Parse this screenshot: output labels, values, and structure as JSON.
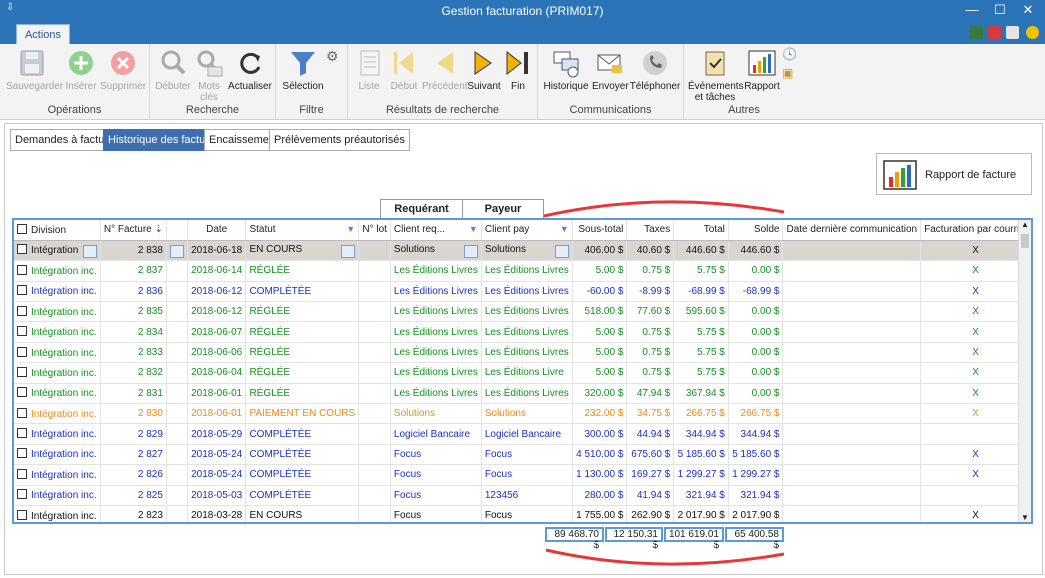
{
  "window": {
    "title": "Gestion facturation (PRIM017)",
    "icon": "menu-pin-icon"
  },
  "ribbon_tab": "Actions",
  "groups": [
    {
      "name": "Opérations",
      "buttons": [
        "Sauvegarder",
        "Insérer",
        "Supprimer"
      ]
    },
    {
      "name": "Recherche",
      "buttons": [
        "Débuter",
        "Mots clés",
        "Actualiser"
      ]
    },
    {
      "name": "Filtre",
      "buttons": [
        "Sélection"
      ]
    },
    {
      "name": "Résultats de recherche",
      "buttons": [
        "Liste",
        "Début",
        "Précédent",
        "Suivant",
        "Fin"
      ]
    },
    {
      "name": "Communications",
      "buttons": [
        "Historique",
        "Envoyer",
        "Téléphoner"
      ]
    },
    {
      "name": "Autres",
      "buttons": [
        "Événements et tâches",
        "Rapport"
      ]
    }
  ],
  "view_tabs": [
    "Demandes à facturer",
    "Historique des factures",
    "Encaissements",
    "Prélèvements préautorisés"
  ],
  "report_button": "Rapport de facture",
  "group_headers": {
    "requerant": "Requérant",
    "payeur": "Payeur"
  },
  "columns": [
    "Division",
    "N° Facture",
    "Date",
    "Statut",
    "N° lot",
    "Client req...",
    "Client pay",
    "Sous-total",
    "Taxes",
    "Total",
    "Solde",
    "Date dernière communication",
    "Facturation par courriel"
  ],
  "rows": [
    {
      "division": "Intégration",
      "no": "2 838",
      "date": "2018-06-18",
      "statut": "EN COURS",
      "lot": "",
      "req": "Solutions",
      "pay": "Solutions",
      "sous": "406.00 $",
      "taxes": "40.60 $",
      "total": "446.60 $",
      "solde": "446.60 $",
      "courriel": "X",
      "color": "bk",
      "selected": true
    },
    {
      "division": "Intégration inc.",
      "no": "2 837",
      "date": "2018-06-14",
      "statut": "RÉGLÉE",
      "lot": "",
      "req": "Les Éditions Livres",
      "pay": "Les Éditions Livres",
      "sous": "5.00 $",
      "taxes": "0.75 $",
      "total": "5.75 $",
      "solde": "0.00 $",
      "courriel": "X",
      "color": "gr"
    },
    {
      "division": "Intégration inc.",
      "no": "2 836",
      "date": "2018-06-12",
      "statut": "COMPLÉTÉE",
      "lot": "",
      "req": "Les Éditions Livres",
      "pay": "Les Éditions Livres",
      "sous": "-60.00 $",
      "taxes": "-8.99 $",
      "total": "-68.99 $",
      "solde": "-68.99 $",
      "courriel": "X",
      "color": "bl"
    },
    {
      "division": "Intégration inc.",
      "no": "2 835",
      "date": "2018-06-12",
      "statut": "RÉGLÉE",
      "lot": "",
      "req": "Les Éditions Livres",
      "pay": "Les Éditions Livres",
      "sous": "518.00 $",
      "taxes": "77.60 $",
      "total": "595.60 $",
      "solde": "0.00 $",
      "courriel": "X",
      "color": "gr"
    },
    {
      "division": "Intégration inc.",
      "no": "2 834",
      "date": "2018-06-07",
      "statut": "RÉGLÉE",
      "lot": "",
      "req": "Les Éditions Livres",
      "pay": "Les Éditions Livres",
      "sous": "5.00 $",
      "taxes": "0.75 $",
      "total": "5.75 $",
      "solde": "0.00 $",
      "courriel": "X",
      "color": "gr"
    },
    {
      "division": "Intégration inc.",
      "no": "2 833",
      "date": "2018-06-06",
      "statut": "RÉGLÉE",
      "lot": "",
      "req": "Les Éditions Livres",
      "pay": "Les Éditions Livres",
      "sous": "5.00 $",
      "taxes": "0.75 $",
      "total": "5.75 $",
      "solde": "0.00 $",
      "courriel": "X",
      "color": "gr"
    },
    {
      "division": "Intégration inc.",
      "no": "2 832",
      "date": "2018-06-04",
      "statut": "RÉGLÉE",
      "lot": "",
      "req": "Les Éditions Livres",
      "pay": "Les Éditions Livre",
      "sous": "5.00 $",
      "taxes": "0.75 $",
      "total": "5.75 $",
      "solde": "0.00 $",
      "courriel": "X",
      "color": "gr"
    },
    {
      "division": "Intégration inc.",
      "no": "2 831",
      "date": "2018-06-01",
      "statut": "RÉGLÉE",
      "lot": "",
      "req": "Les Éditions Livres",
      "pay": "Les Éditions Livres",
      "sous": "320.00 $",
      "taxes": "47.94 $",
      "total": "367.94 $",
      "solde": "0.00 $",
      "courriel": "X",
      "color": "gr"
    },
    {
      "division": "Intégration inc.",
      "no": "2 830",
      "date": "2018-06-01",
      "statut": "PAIEMENT EN COURS",
      "lot": "",
      "req": "Solutions",
      "pay": "Solutions",
      "sous": "232.00 $",
      "taxes": "34.75 $",
      "total": "266.75 $",
      "solde": "266.75 $",
      "courriel": "X",
      "color": "or"
    },
    {
      "division": "Intégration inc.",
      "no": "2 829",
      "date": "2018-05-29",
      "statut": "COMPLÉTÉE",
      "lot": "",
      "req": "Logiciel Bancaire",
      "pay": "Logiciel Bancaire",
      "sous": "300.00 $",
      "taxes": "44.94 $",
      "total": "344.94 $",
      "solde": "344.94 $",
      "courriel": "",
      "color": "bl"
    },
    {
      "division": "Intégration inc.",
      "no": "2 827",
      "date": "2018-05-24",
      "statut": "COMPLÉTÉE",
      "lot": "",
      "req": "Focus",
      "pay": "Focus",
      "sous": "4 510.00 $",
      "taxes": "675.60 $",
      "total": "5 185.60 $",
      "solde": "5 185.60 $",
      "courriel": "X",
      "color": "bl"
    },
    {
      "division": "Intégration inc.",
      "no": "2 826",
      "date": "2018-05-24",
      "statut": "COMPLÉTÉE",
      "lot": "",
      "req": "Focus",
      "pay": "Focus",
      "sous": "1 130.00 $",
      "taxes": "169.27 $",
      "total": "1 299.27 $",
      "solde": "1 299.27 $",
      "courriel": "X",
      "color": "bl"
    },
    {
      "division": "Intégration inc.",
      "no": "2 825",
      "date": "2018-05-03",
      "statut": "COMPLÉTÉE",
      "lot": "",
      "req": "Focus",
      "pay": "123456",
      "sous": "280.00 $",
      "taxes": "41.94 $",
      "total": "321.94 $",
      "solde": "321.94 $",
      "courriel": "",
      "color": "bl"
    },
    {
      "division": "Intégration inc.",
      "no": "2 823",
      "date": "2018-03-28",
      "statut": "EN COURS",
      "lot": "",
      "req": "Focus",
      "pay": "Focus",
      "sous": "1 755.00 $",
      "taxes": "262.90 $",
      "total": "2 017.90 $",
      "solde": "2 017.90 $",
      "courriel": "X",
      "color": "bk"
    }
  ],
  "totals": {
    "sous": "89 468.70 $",
    "taxes": "12 150.31 $",
    "total": "101 619.01 $",
    "solde": "65 400.58 $"
  }
}
